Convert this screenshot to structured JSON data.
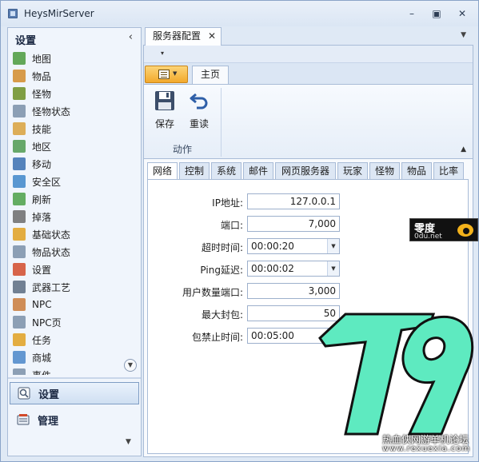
{
  "window": {
    "title": "HeysMirServer"
  },
  "sidebar": {
    "header": "设置",
    "items": [
      {
        "label": "地图",
        "icon": "map-icon",
        "color": "#4a9a3c"
      },
      {
        "label": "物品",
        "icon": "box-icon",
        "color": "#d28b2a"
      },
      {
        "label": "怪物",
        "icon": "monster-icon",
        "color": "#6b8e23"
      },
      {
        "label": "怪物状态",
        "icon": "monster-stats-icon",
        "color": "#7a8fa8"
      },
      {
        "label": "技能",
        "icon": "skill-icon",
        "color": "#d9a13b"
      },
      {
        "label": "地区",
        "icon": "region-icon",
        "color": "#4f9a50"
      },
      {
        "label": "移动",
        "icon": "move-icon",
        "color": "#3a6fb0"
      },
      {
        "label": "安全区",
        "icon": "safezone-icon",
        "color": "#3e86c9"
      },
      {
        "label": "刷新",
        "icon": "refresh-icon",
        "color": "#4ba046"
      },
      {
        "label": "掉落",
        "icon": "drop-icon",
        "color": "#6b6b6b"
      },
      {
        "label": "基础状态",
        "icon": "bar-chart-icon",
        "color": "#e0a020"
      },
      {
        "label": "物品状态",
        "icon": "item-stats-icon",
        "color": "#7a8fa8"
      },
      {
        "label": "设置",
        "icon": "settings-circle-icon",
        "color": "#d24a2a"
      },
      {
        "label": "武器工艺",
        "icon": "weapon-craft-icon",
        "color": "#5a6b80"
      },
      {
        "label": "NPC",
        "icon": "npc-icon",
        "color": "#c97a3a"
      },
      {
        "label": "NPC页",
        "icon": "npc-page-icon",
        "color": "#7a8fa8"
      },
      {
        "label": "任务",
        "icon": "quest-icon",
        "color": "#e0a020"
      },
      {
        "label": "商城",
        "icon": "shop-icon",
        "color": "#4a86c9"
      },
      {
        "label": "事件",
        "icon": "event-icon",
        "color": "#7a8fa8"
      }
    ],
    "groups": [
      {
        "label": "设置",
        "icon": "settings-group-icon",
        "active": true
      },
      {
        "label": "管理",
        "icon": "manage-group-icon",
        "active": false
      }
    ]
  },
  "document": {
    "tab_label": "服务器配置",
    "ribbon": {
      "page_tab": "主页",
      "buttons": [
        {
          "label": "保存",
          "icon": "save-icon"
        },
        {
          "label": "重读",
          "icon": "reload-icon"
        }
      ],
      "group_label": "动作"
    },
    "tabs": [
      "网络",
      "控制",
      "系统",
      "邮件",
      "网页服务器",
      "玩家",
      "怪物",
      "物品",
      "比率"
    ],
    "active_tab": "网络",
    "fields": [
      {
        "label": "IP地址:",
        "value": "127.0.0.1",
        "type": "num"
      },
      {
        "label": "端口:",
        "value": "7,000",
        "type": "num"
      },
      {
        "label": "超时时间:",
        "value": "00:00:20",
        "type": "time"
      },
      {
        "label": "Ping延迟:",
        "value": "00:00:02",
        "type": "time"
      },
      {
        "label": "用户数量端口:",
        "value": "3,000",
        "type": "num"
      },
      {
        "label": "最大封包:",
        "value": "50",
        "type": "num"
      },
      {
        "label": "包禁止时间:",
        "value": "00:05:00",
        "type": "time"
      }
    ]
  },
  "watermark": {
    "badge_title": "零度",
    "badge_domain": "0du.net",
    "logo_text": "T9",
    "caption": "热血侠网游单机论坛",
    "caption_url": "www.rexuexia.com"
  }
}
